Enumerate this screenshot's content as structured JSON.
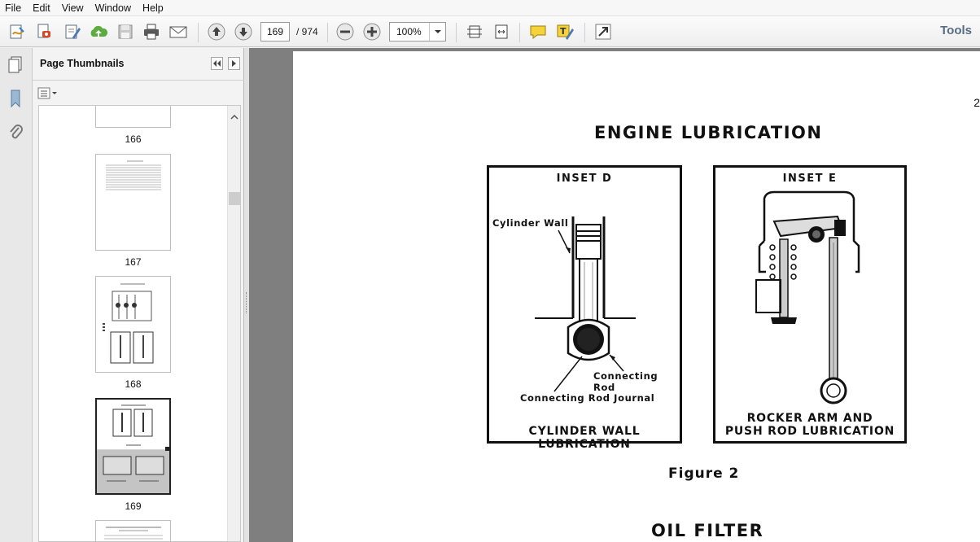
{
  "menu": [
    "File",
    "Edit",
    "View",
    "Window",
    "Help"
  ],
  "toolbar": {
    "page_current": "169",
    "page_total": "/ 974",
    "zoom": "100%",
    "tools_label": "Tools"
  },
  "thumbnail_panel": {
    "title": "Page Thumbnails",
    "thumbnails": [
      {
        "label": "166"
      },
      {
        "label": "167"
      },
      {
        "label": "168"
      },
      {
        "label": "169",
        "selected": true
      },
      {
        "label": ""
      }
    ]
  },
  "document": {
    "page_edge_number": "2",
    "title": "ENGINE LUBRICATION",
    "inset_d": {
      "title": "INSET D",
      "caption": "CYLINDER WALL LUBRICATION",
      "labels": [
        "Cylinder Wall",
        "Connecting Rod",
        "Connecting Rod Journal"
      ]
    },
    "inset_e": {
      "title": "INSET E",
      "caption_line1": "ROCKER ARM AND",
      "caption_line2": "PUSH ROD LUBRICATION"
    },
    "figure_caption": "Figure 2",
    "next_heading": "OIL FILTER"
  }
}
